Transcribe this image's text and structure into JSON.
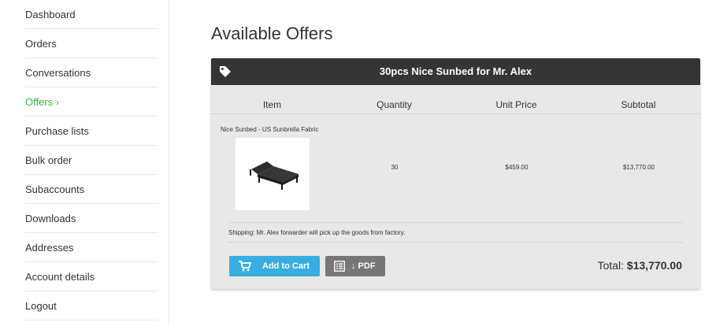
{
  "sidebar": {
    "items": [
      {
        "label": "Dashboard"
      },
      {
        "label": "Orders"
      },
      {
        "label": "Conversations"
      },
      {
        "label": "Offers",
        "chevron": "›",
        "active": true
      },
      {
        "label": "Purchase lists"
      },
      {
        "label": "Bulk order"
      },
      {
        "label": "Subaccounts"
      },
      {
        "label": "Downloads"
      },
      {
        "label": "Addresses"
      },
      {
        "label": "Account details"
      },
      {
        "label": "Logout"
      }
    ]
  },
  "main": {
    "page_title": "Available Offers",
    "offer": {
      "title": "30pcs Nice Sunbed for Mr. Alex",
      "icon": "tag-icon",
      "columns": [
        "Item",
        "Quantity",
        "Unit Price",
        "Subtotal"
      ],
      "item": {
        "name": "Nice Sunbed - US Sunbrella Fabric",
        "quantity": "30",
        "unit_price": "$459.00",
        "subtotal": "$13,770.00"
      },
      "shipping": "Shipping: Mr. Alex forwarder will pick up the goods from factory.",
      "add_to_cart_label": "Add to Cart",
      "pdf_label": "↓ PDF",
      "total_label": "Total:",
      "total_amount": "$13,770.00"
    }
  },
  "colors": {
    "accent_active": "#3bb54a",
    "header_bg": "#353535",
    "cart_button": "#3aaee0",
    "pdf_button": "#777777",
    "card_bg": "#e8e8e8"
  }
}
